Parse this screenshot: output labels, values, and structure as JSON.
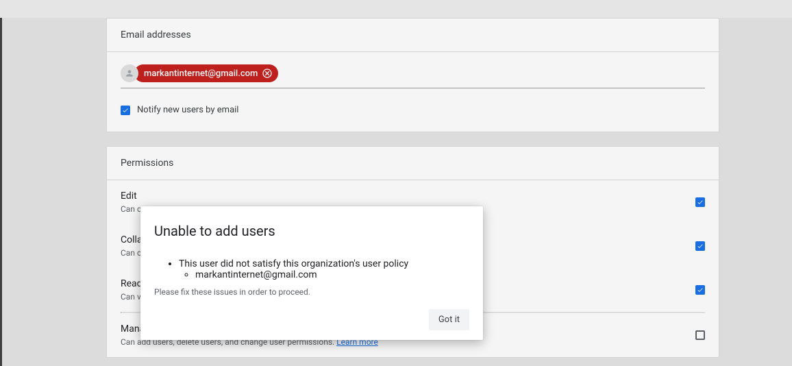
{
  "emailCard": {
    "header": "Email addresses",
    "chipEmail": "markantinternet@gmail.com",
    "notifyLabel": "Notify new users by email",
    "notifyChecked": true
  },
  "permissionsCard": {
    "header": "Permissions",
    "items": [
      {
        "title": "Edit",
        "desc": "Can cr",
        "checked": true
      },
      {
        "title": "Collab",
        "desc": "Can cr",
        "checked": true
      },
      {
        "title": "Read",
        "desc": "Can vi",
        "checked": true
      }
    ],
    "manage": {
      "title": "Manage Users",
      "desc": "Can add users, delete users, and change user permissions. ",
      "learnMore": "Learn more",
      "checked": false
    }
  },
  "modal": {
    "title": "Unable to add users",
    "policyMsg": "This user did not satisfy this organization's user policy",
    "failedEmail": "markantinternet@gmail.com",
    "fixMsg": "Please fix these issues in order to proceed.",
    "button": "Got it"
  }
}
